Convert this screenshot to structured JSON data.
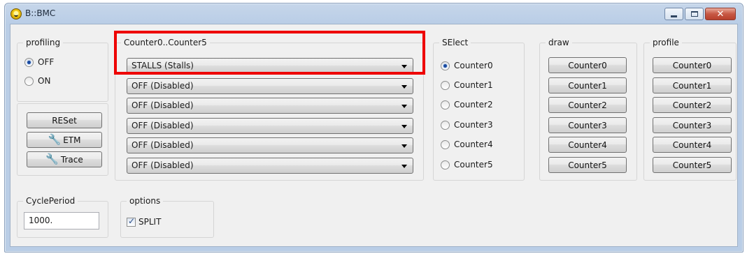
{
  "window": {
    "title": "B::BMC"
  },
  "caption_buttons": {
    "minimize": "",
    "maximize": "",
    "close": "✕"
  },
  "profiling": {
    "label": "profiling",
    "options": [
      {
        "label": "OFF",
        "selected": true
      },
      {
        "label": "ON",
        "selected": false
      }
    ]
  },
  "actions": {
    "reset": "RESet",
    "etm": "ETM",
    "trace": "Trace"
  },
  "counters": {
    "label": "Counter0..Counter5",
    "values": [
      "STALLS (Stalls)",
      "OFF (Disabled)",
      "OFF (Disabled)",
      "OFF (Disabled)",
      "OFF (Disabled)",
      "OFF (Disabled)"
    ]
  },
  "select": {
    "label": "SElect",
    "options": [
      {
        "label": "Counter0",
        "selected": true
      },
      {
        "label": "Counter1",
        "selected": false
      },
      {
        "label": "Counter2",
        "selected": false
      },
      {
        "label": "Counter3",
        "selected": false
      },
      {
        "label": "Counter4",
        "selected": false
      },
      {
        "label": "Counter5",
        "selected": false
      }
    ]
  },
  "draw": {
    "label": "draw",
    "buttons": [
      "Counter0",
      "Counter1",
      "Counter2",
      "Counter3",
      "Counter4",
      "Counter5"
    ]
  },
  "profile": {
    "label": "profile",
    "buttons": [
      "Counter0",
      "Counter1",
      "Counter2",
      "Counter3",
      "Counter4",
      "Counter5"
    ]
  },
  "cycle_period": {
    "label": "CyclePeriod",
    "value": "1000."
  },
  "options": {
    "label": "options",
    "split_label": "SPLIT",
    "split_checked": true
  },
  "colors": {
    "highlight": "#ee0000",
    "radio_dot": "#1a4aa0"
  }
}
